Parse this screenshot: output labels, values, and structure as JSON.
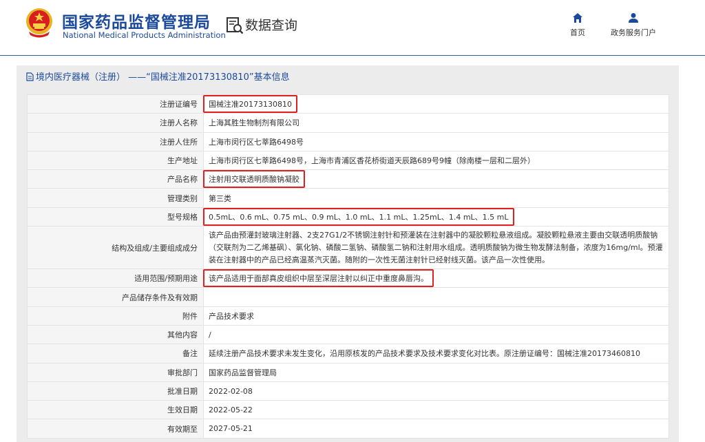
{
  "header": {
    "site_name_cn": "国家药品监督管理局",
    "site_name_en": "National Medical Products Administration",
    "section_title": "数据查询",
    "nav": [
      {
        "label": "首页",
        "icon": "home-icon"
      },
      {
        "label": "政务服务门户",
        "icon": "user-icon"
      }
    ]
  },
  "panel": {
    "title": "境内医疗器械（注册） ——“国械注准20173130810”基本信息"
  },
  "table": {
    "rows": [
      {
        "label": "注册证编号",
        "value": "国械注准20173130810",
        "highlight": true
      },
      {
        "label": "注册人名称",
        "value": "上海其胜生物制剂有限公司"
      },
      {
        "label": "注册人住所",
        "value": "上海市闵行区七莘路6498号"
      },
      {
        "label": "生产地址",
        "value": "上海市闵行区七莘路6498号，上海市青浦区香花桥街道天辰路689号9幢（除南楼一层和二层外）"
      },
      {
        "label": "产品名称",
        "value": "注射用交联透明质酸钠凝胶",
        "highlight": true
      },
      {
        "label": "管理类别",
        "value": "第三类"
      },
      {
        "label": "型号规格",
        "value": "0.5mL、0.6 mL、0.75 mL、0.9 mL、1.0 mL、1.1 mL、1.25mL、1.4 mL、1.5 mL",
        "highlight": true
      },
      {
        "label": "结构及组成/主要组成成分",
        "value": "该产品由预灌封玻璃注射器、2支27G1/2不锈钢注射针和预灌装在注射器中的凝胶颗粒悬液组成。凝胶颗粒悬液主要由交联透明质酸钠（交联剂为二乙烯基砜）、氯化钠、磷酸二氢钠、磷酸氢二钠和注射用水组成。透明质酸钠为微生物发酵法制备，浓度为16mg/ml。预灌装在注射器中的产品已经高温蒸汽灭菌。随附的一次性无菌注射针已经射线灭菌。该产品一次性使用。",
        "tall": true
      },
      {
        "label": "适用范围/预期用途",
        "value": "该产品适用于面部真皮组织中层至深层注射以纠正中重度鼻唇沟。",
        "highlight": true
      },
      {
        "label": "产品储存条件及有效期",
        "value": ""
      },
      {
        "label": "附件",
        "value": "产品技术要求"
      },
      {
        "label": "其他内容",
        "value": "/"
      },
      {
        "label": "备注",
        "value": "延续注册产品技术要求未发生变化，沿用原核发的产品技术要求及技术要求变化对比表。原注册证编号：国械注准20173460810"
      },
      {
        "label": "审批部门",
        "value": "国家药品监督管理局"
      },
      {
        "label": "批准日期",
        "value": "2022-02-08"
      },
      {
        "label": "生效日期",
        "value": "2022-05-22"
      },
      {
        "label": "有效期至",
        "value": "2027-05-21"
      }
    ]
  },
  "colors": {
    "brand_blue": "#1b4a9c",
    "highlight_red": "#e02020",
    "emblem_red": "#d71f1f",
    "emblem_gold": "#e6b422"
  }
}
